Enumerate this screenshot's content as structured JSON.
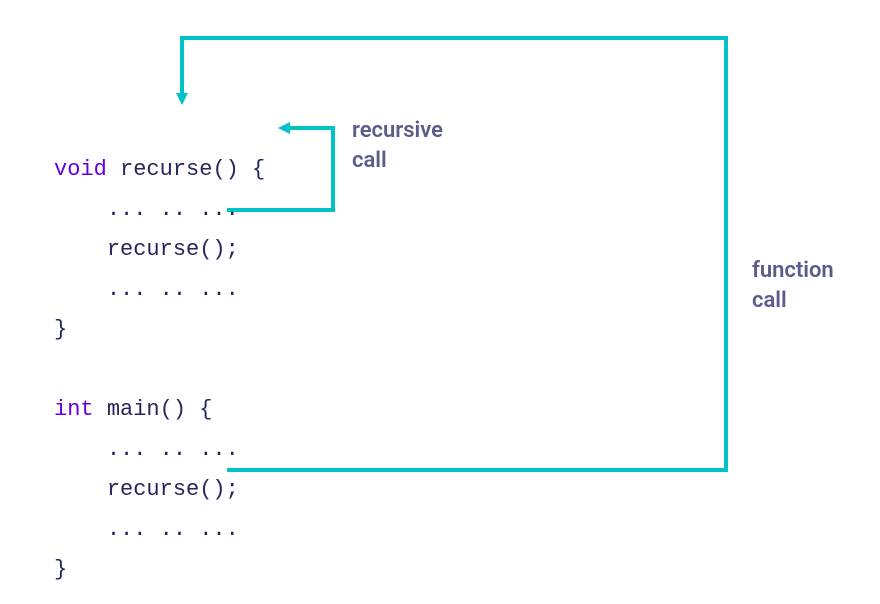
{
  "code": {
    "recurse": {
      "keyword": "void",
      "name": "recurse",
      "sigOpen": "() {",
      "dots": "... .. ...",
      "call": "recurse();",
      "close": "}"
    },
    "main": {
      "keyword": "int",
      "name": "main",
      "sigOpen": "() {",
      "dots": "... .. ...",
      "call": "recurse();",
      "close": "}"
    }
  },
  "labels": {
    "recursive": {
      "line1": "recursive",
      "line2": "call"
    },
    "function": {
      "line1": "function",
      "line2": "call"
    }
  },
  "colors": {
    "arrow": "#00c2c7",
    "keyword": "#6400e4",
    "text": "#25265e",
    "label": "#5c5c8a"
  }
}
